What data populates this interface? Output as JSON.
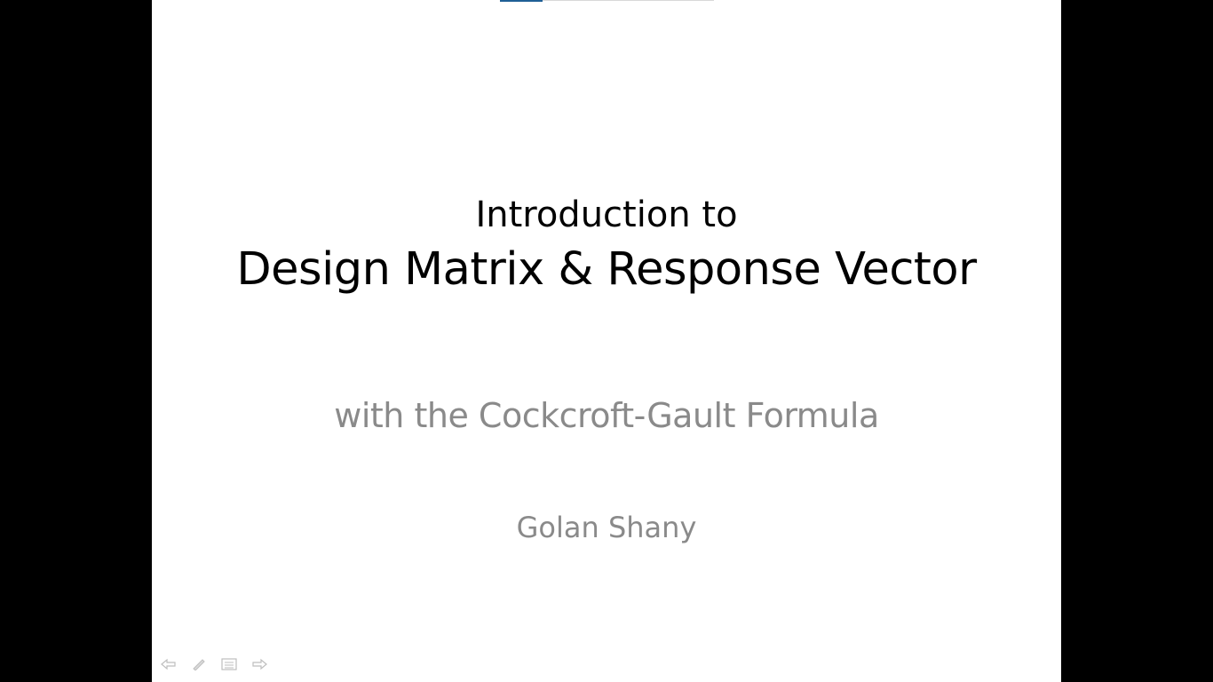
{
  "slide": {
    "title_line1": "Introduction to",
    "title_line2": "Design Matrix & Response Vector",
    "subtitle": "with the Cockcroft-Gault Formula",
    "author": "Golan Shany"
  },
  "progress": {
    "fraction": 0.2
  },
  "nav": {
    "buttons": [
      {
        "name": "previous-slide-icon",
        "kind": "prev"
      },
      {
        "name": "pen-icon",
        "kind": "pen"
      },
      {
        "name": "slide-menu-icon",
        "kind": "menu"
      },
      {
        "name": "next-slide-icon",
        "kind": "next"
      }
    ]
  },
  "colors": {
    "background": "#000000",
    "slide_background": "#ffffff",
    "title_text": "#000000",
    "subtitle_text": "#8a8a8a",
    "progress_accent": "#1f5f96"
  }
}
